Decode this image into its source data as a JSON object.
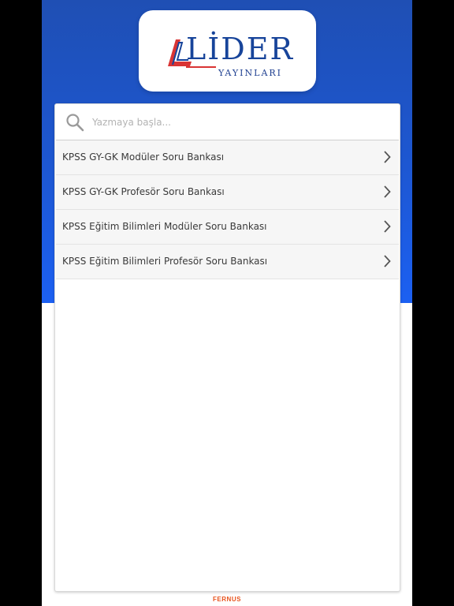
{
  "brand": {
    "logo_main": "LİDER",
    "logo_sub": "YAYINLARI",
    "colors": {
      "primary": "#1d57d2",
      "accent": "#d93434",
      "footer": "#e8531d"
    }
  },
  "search": {
    "placeholder": "Yazmaya başla...",
    "value": "",
    "icon": "search-icon"
  },
  "list": {
    "items": [
      {
        "label": "KPSS GY-GK Modüler Soru Bankası",
        "icon": "chevron-right-icon"
      },
      {
        "label": "KPSS GY-GK Profesör Soru Bankası",
        "icon": "chevron-right-icon"
      },
      {
        "label": "KPSS Eğitim Bilimleri Modüler Soru Bankası",
        "icon": "chevron-right-icon"
      },
      {
        "label": "KPSS Eğitim Bilimleri Profesör Soru Bankası",
        "icon": "chevron-right-icon"
      }
    ]
  },
  "footer": {
    "text": "FERNUS"
  }
}
